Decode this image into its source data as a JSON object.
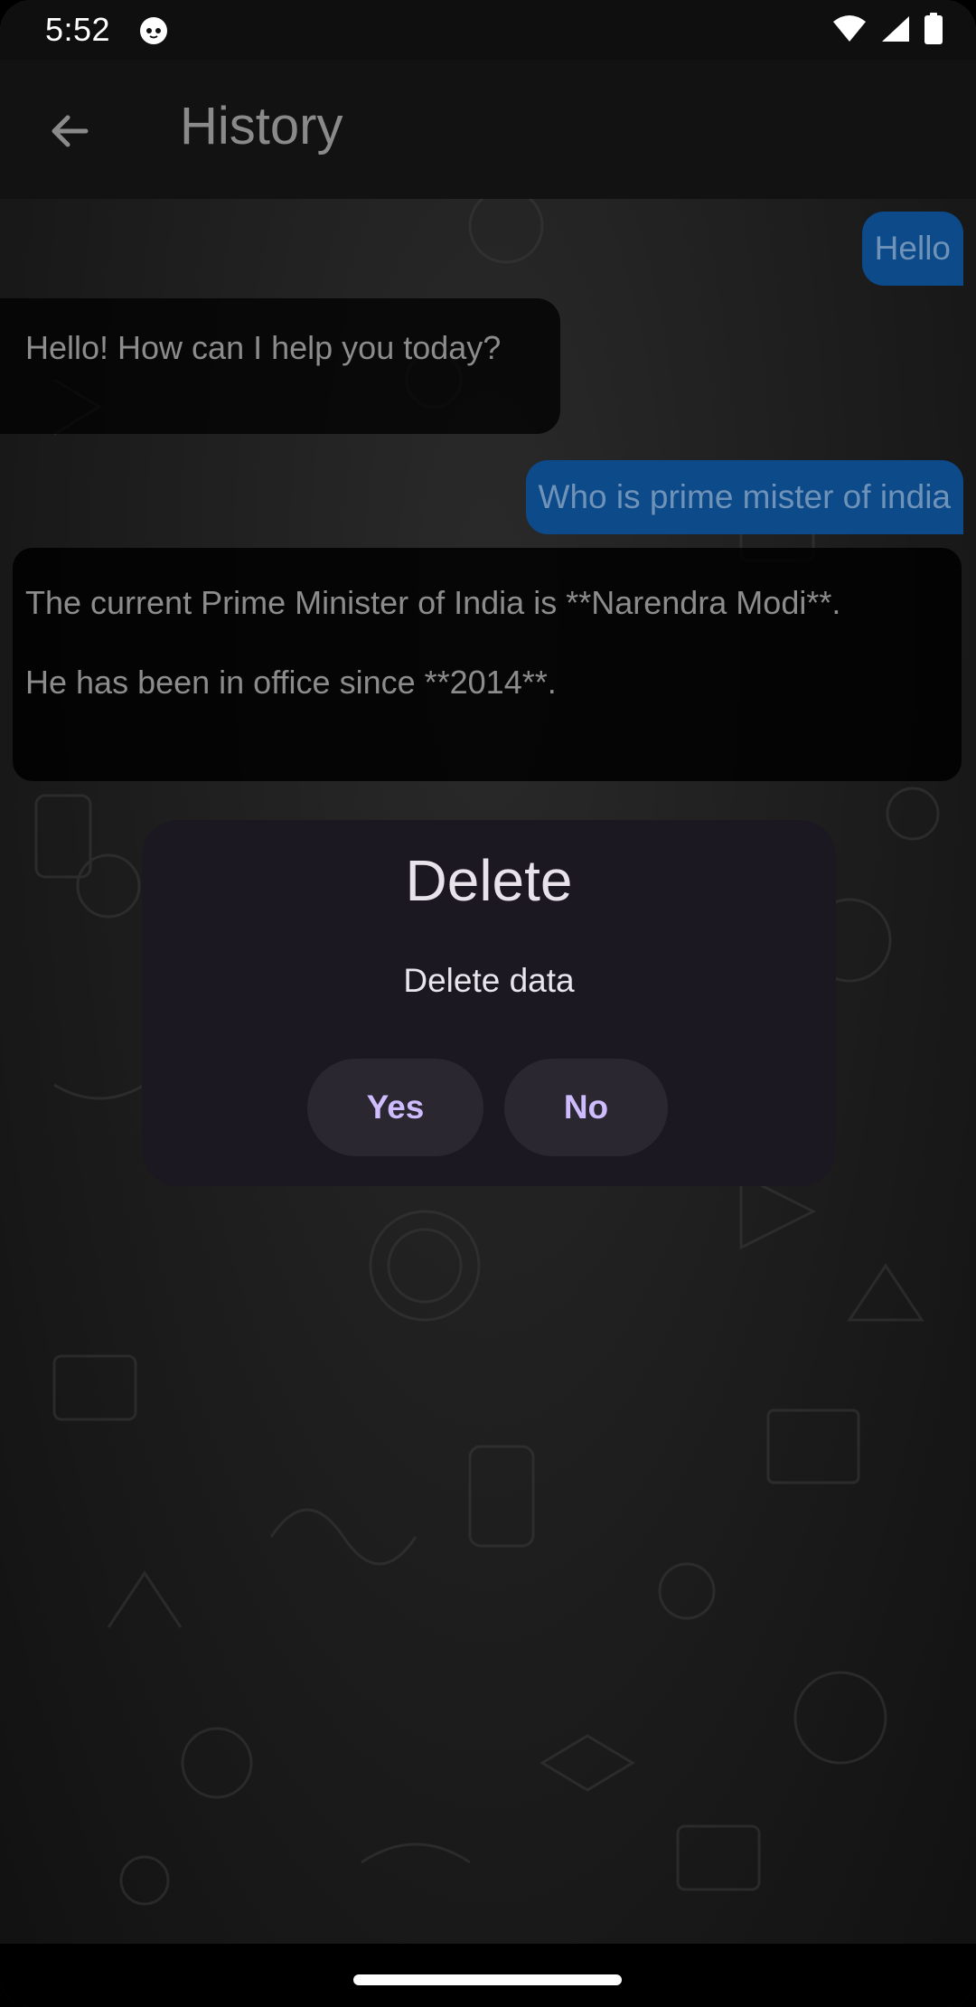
{
  "status_bar": {
    "time": "5:52",
    "icons": [
      "cat-face-icon",
      "wifi-icon",
      "cellular-signal-icon",
      "battery-icon"
    ]
  },
  "app_bar": {
    "back_icon": "arrow-back-icon",
    "title": "History"
  },
  "chat": {
    "messages": [
      {
        "role": "user",
        "text": "Hello"
      },
      {
        "role": "bot",
        "text": "Hello! How can I help you today?"
      },
      {
        "role": "user",
        "text": "Who is prime mister of india"
      },
      {
        "role": "bot",
        "lines": [
          "The current Prime Minister of India is **Narendra Modi**.",
          "He has been in office since **2014**."
        ]
      }
    ]
  },
  "dialog": {
    "title": "Delete",
    "message": "Delete data",
    "yes_label": "Yes",
    "no_label": "No"
  },
  "colors": {
    "user_bubble": "#0d4a8a",
    "dialog_surface": "#1b1821",
    "dialog_button_text": "#cfbcff"
  }
}
